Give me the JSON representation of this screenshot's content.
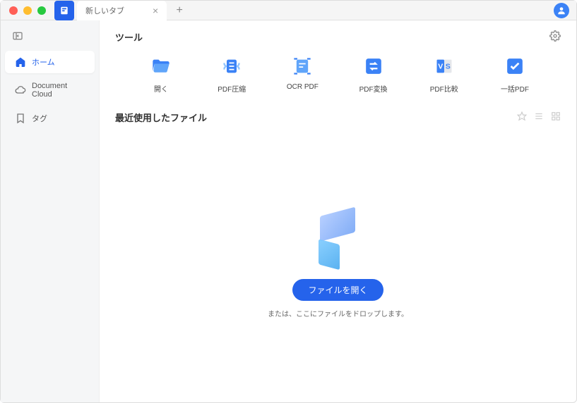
{
  "titlebar": {
    "tab_title": "新しいタブ"
  },
  "sidebar": {
    "items": [
      {
        "label": "ホーム"
      },
      {
        "label": "Document Cloud"
      },
      {
        "label": "タグ"
      }
    ]
  },
  "main": {
    "tools_title": "ツール",
    "tools": [
      {
        "label": "開く"
      },
      {
        "label": "PDF圧縮"
      },
      {
        "label": "OCR PDF"
      },
      {
        "label": "PDF変換"
      },
      {
        "label": "PDF比較"
      },
      {
        "label": "一括PDF"
      }
    ],
    "recent_title": "最近使用したファイル",
    "open_button": "ファイルを開く",
    "drop_hint": "または、ここにファイルをドロップします。"
  }
}
